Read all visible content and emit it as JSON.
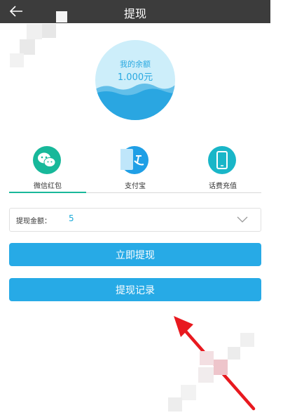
{
  "header": {
    "title": "提现",
    "back_icon": "back-arrow-icon"
  },
  "balance": {
    "label": "我的余额",
    "amount": "1.000元"
  },
  "methods": [
    {
      "label": "微信红包",
      "icon": "wechat-icon",
      "color": "#17b89a"
    },
    {
      "label": "支付宝",
      "icon": "alipay-icon",
      "color": "#1f9fe6"
    },
    {
      "label": "话费充值",
      "icon": "phone-icon",
      "color": "#19b6c8"
    }
  ],
  "amount_field": {
    "label": "提现金额：",
    "value": "5"
  },
  "buttons": {
    "withdraw": "立即提现",
    "records": "提现记录"
  },
  "colors": {
    "accent": "#27aae6",
    "header": "#3c3c3c",
    "annotation_arrow": "#e8191f"
  }
}
